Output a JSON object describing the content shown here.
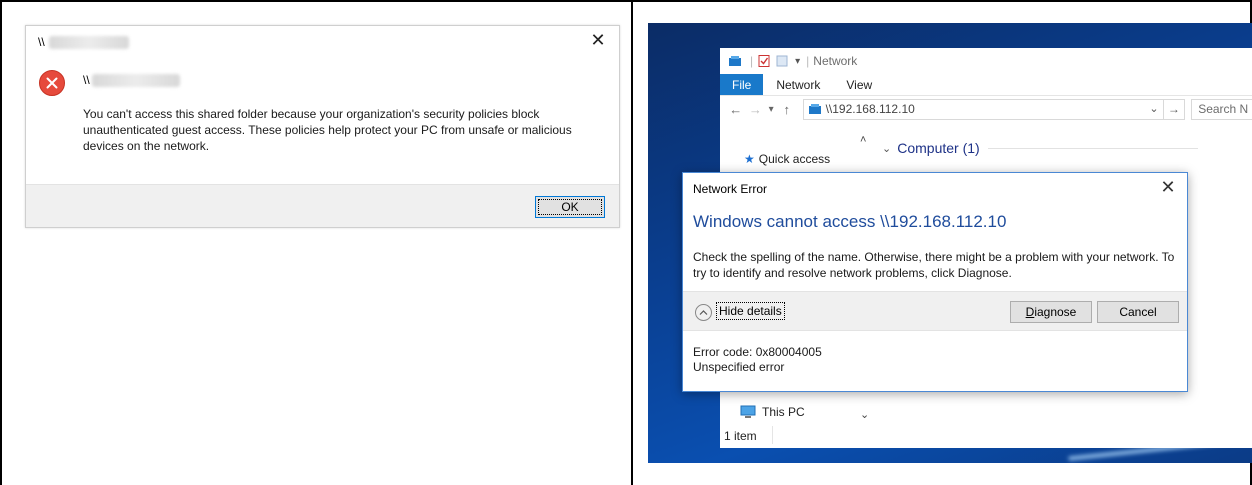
{
  "left_dialog": {
    "title_prefix": "\\\\",
    "close_glyph": "✕",
    "path_prefix": "\\\\",
    "message": "You can't access this shared folder because your organization's security policies block unauthenticated guest access. These policies help protect your PC from unsafe or malicious devices on the network.",
    "ok_label": "OK",
    "icon": "error-icon",
    "icon_color": "#e64a3c"
  },
  "explorer": {
    "window_title": "Network",
    "tabs": [
      {
        "label": "File"
      },
      {
        "label": "Network"
      },
      {
        "label": "View"
      }
    ],
    "address": "\\\\192.168.112.10",
    "search_placeholder": "Search N",
    "nav": {
      "quick_access": "Quick access",
      "this_pc": "This PC"
    },
    "group_header": "Computer (1)",
    "status": "1 item",
    "accent_color": "#1979ca"
  },
  "network_error": {
    "title": "Network Error",
    "close_glyph": "✕",
    "heading": "Windows cannot access \\\\192.168.112.10",
    "body": "Check the spelling of the name. Otherwise, there might be a problem with your network. To try to identify and resolve network problems, click Diagnose.",
    "hide_details": "Hide details",
    "diagnose_rest": "iagnose",
    "diagnose_accel": "D",
    "cancel_label": "Cancel",
    "error_code": "Error code: 0x80004005",
    "error_text": "Unspecified error",
    "heading_color": "#1f4c9c"
  }
}
